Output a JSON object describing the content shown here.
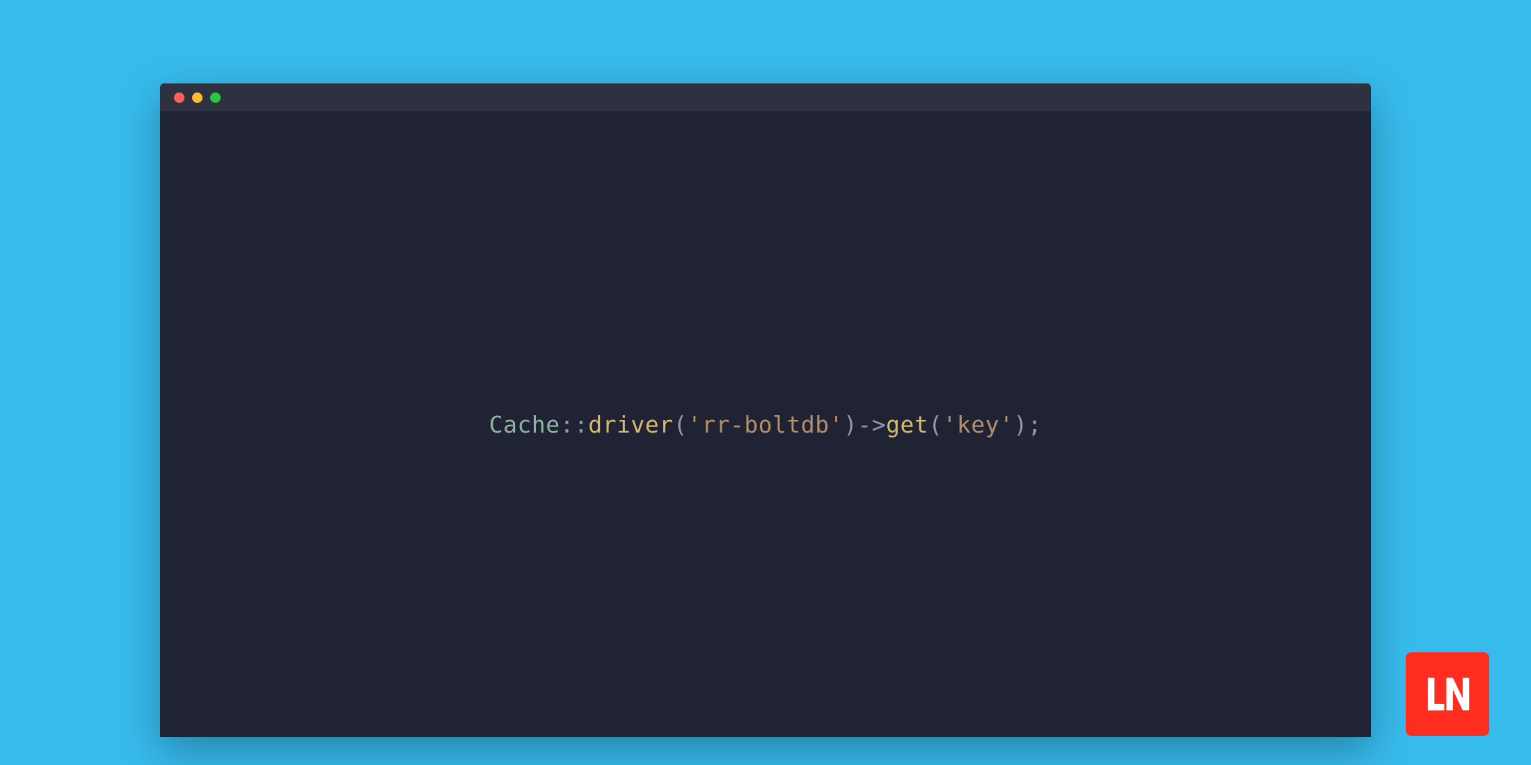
{
  "colors": {
    "background": "#37bbed",
    "windowBg": "#1f2333",
    "titlebarBg": "#2e3240",
    "trafficRed": "#ff5f56",
    "trafficYellow": "#ffbd2e",
    "trafficGreen": "#27c93f",
    "logoRed": "#ff2d20"
  },
  "code": {
    "class": "Cache",
    "scope": "::",
    "method1": "driver",
    "paren1a": "(",
    "quote1a": "'",
    "string1": "rr-boltdb",
    "quote1b": "'",
    "paren1b": ")",
    "arrow": "->",
    "method2": "get",
    "paren2a": "(",
    "quote2a": "'",
    "string2": "key",
    "quote2b": "'",
    "paren2b": ")",
    "semi": ";"
  },
  "logo": {
    "text": "LN"
  }
}
